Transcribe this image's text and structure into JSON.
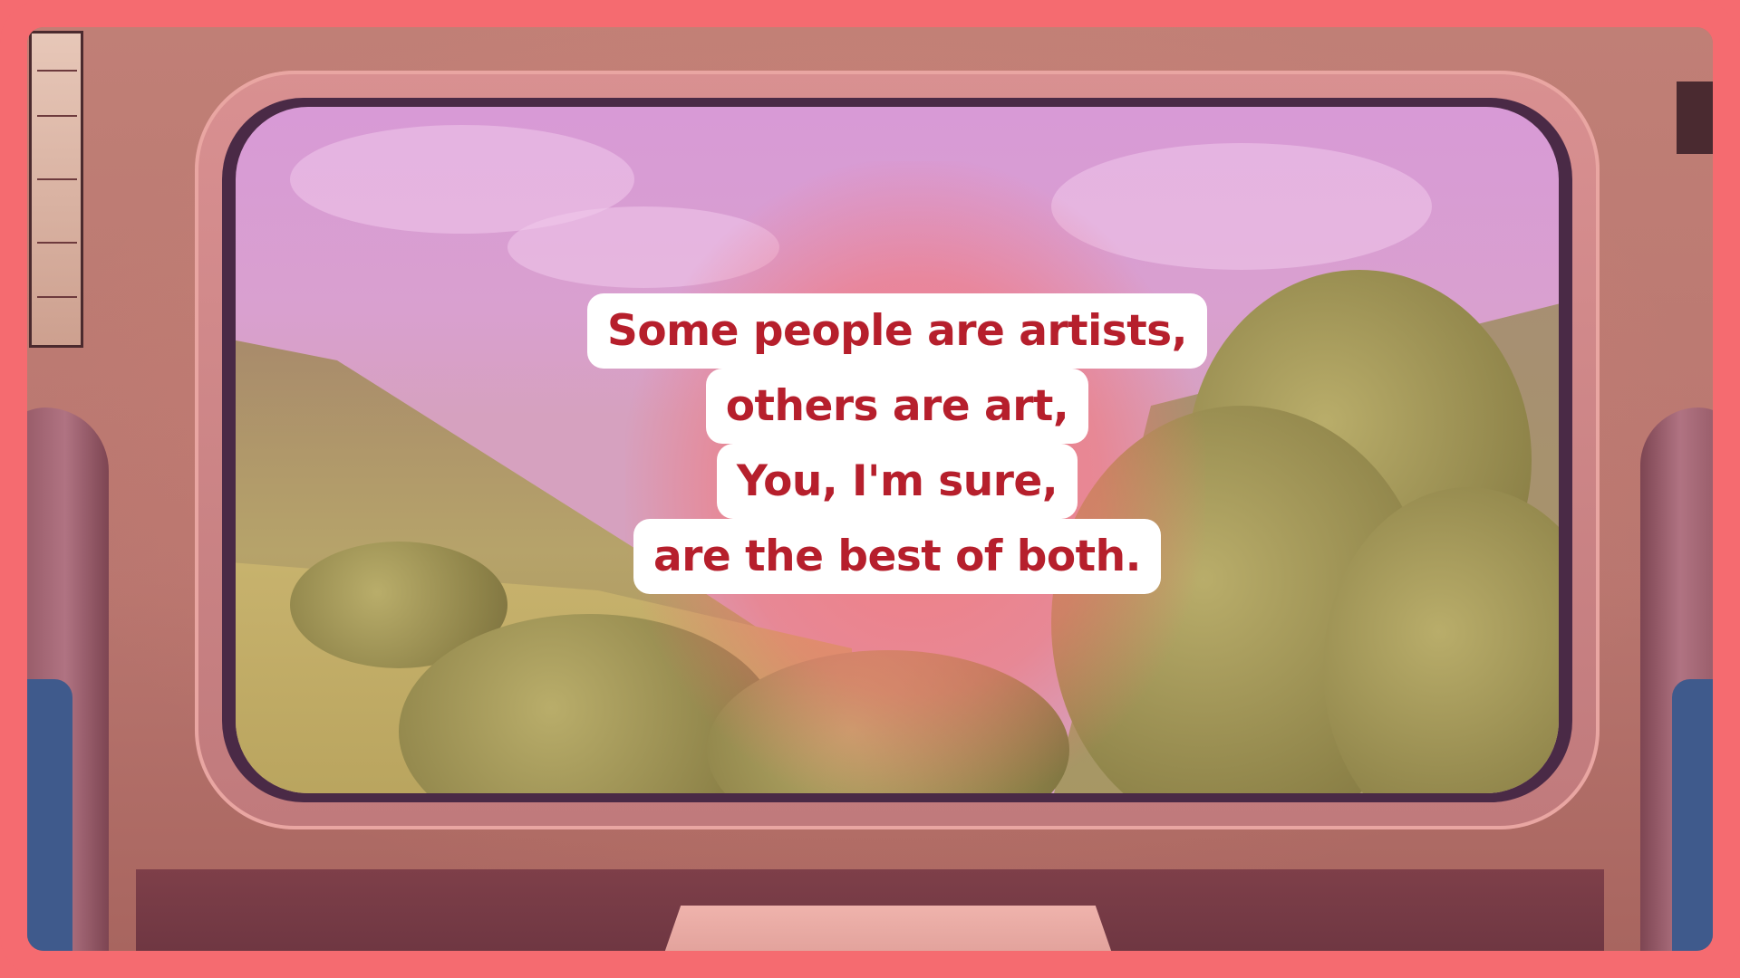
{
  "quote": {
    "lines": [
      "Some people are artists,",
      "others are art,",
      "You, I'm sure,",
      "are the best of both."
    ]
  },
  "colors": {
    "frame": "#f56b70",
    "quote_text": "#b61f2c",
    "quote_background": "#ffffff"
  },
  "icons": [
    "train-window-scene"
  ]
}
